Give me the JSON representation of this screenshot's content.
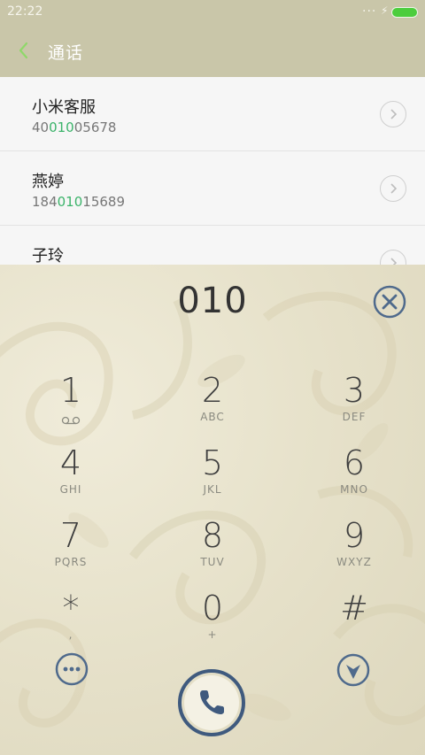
{
  "status_bar": {
    "time": "22:22",
    "dots": "...",
    "bolt": "⚡",
    "battery_color": "#4ccd3d"
  },
  "header": {
    "title": "通话"
  },
  "contacts": [
    {
      "name": "小米客服",
      "number_pre": "40",
      "number_match": "010",
      "number_post": "05678"
    },
    {
      "name": "燕婷",
      "number_pre": "184",
      "number_match": "010",
      "number_post": "15689"
    },
    {
      "name": "子玲",
      "number_pre": "",
      "number_match": "",
      "number_post": ""
    }
  ],
  "dialpad": {
    "input": "010",
    "keys": [
      {
        "num": "1",
        "letters": "",
        "icon": "voicemail-icon"
      },
      {
        "num": "2",
        "letters": "ABC"
      },
      {
        "num": "3",
        "letters": "DEF"
      },
      {
        "num": "4",
        "letters": "GHI"
      },
      {
        "num": "5",
        "letters": "JKL"
      },
      {
        "num": "6",
        "letters": "MNO"
      },
      {
        "num": "7",
        "letters": "PQRS"
      },
      {
        "num": "8",
        "letters": "TUV"
      },
      {
        "num": "9",
        "letters": "WXYZ"
      },
      {
        "num": "*",
        "letters": ","
      },
      {
        "num": "0",
        "letters": "+"
      },
      {
        "num": "#",
        "letters": ""
      }
    ]
  },
  "colors": {
    "header": "#c9c6a9",
    "match_highlight": "#3bb36a",
    "call_button": "#3f5a7e",
    "back_icon": "#8fd86a"
  }
}
